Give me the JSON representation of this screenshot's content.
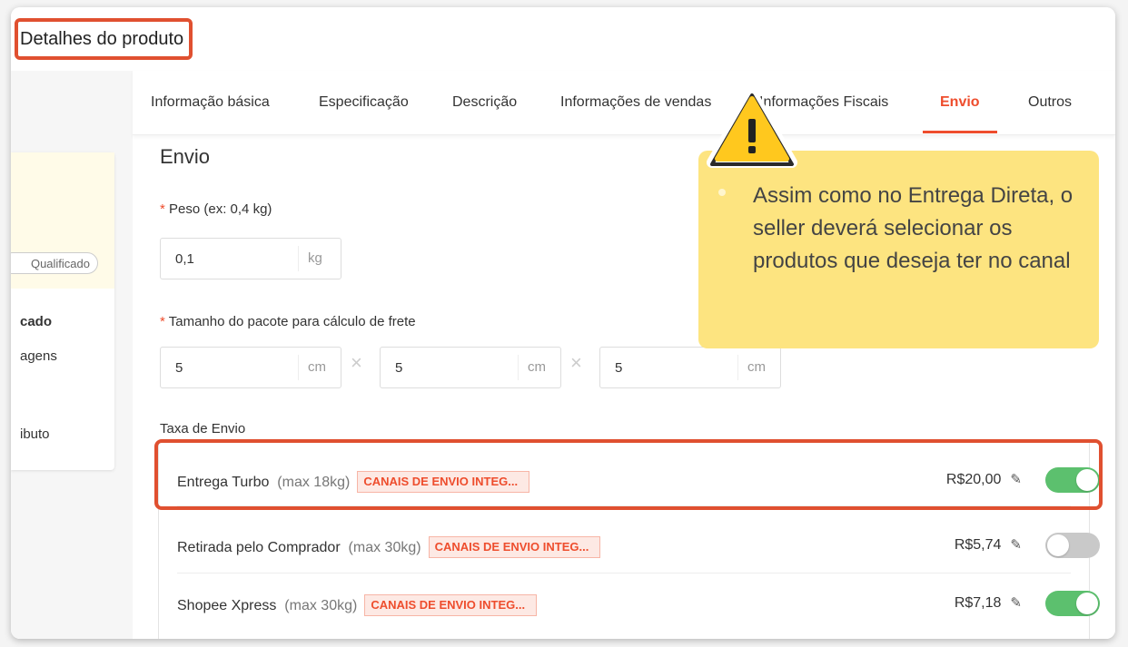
{
  "header": {
    "title": "Detalhes do produto"
  },
  "left": {
    "badge": "Qualificado",
    "items": [
      "cado",
      "agens",
      "ibuto"
    ]
  },
  "tabs": [
    {
      "label": "Informação básica"
    },
    {
      "label": "Especificação"
    },
    {
      "label": "Descrição"
    },
    {
      "label": "Informações de vendas"
    },
    {
      "label": "Informações Fiscais"
    },
    {
      "label": "Envio"
    },
    {
      "label": "Outros"
    }
  ],
  "section_title": "Envio",
  "weight": {
    "required": "*",
    "label": "Peso (ex: 0,4 kg)",
    "value": "0,1",
    "unit": "kg"
  },
  "package": {
    "required": "*",
    "label": "Tamanho do pacote para cálculo de frete",
    "dims": [
      {
        "value": "5",
        "unit": "cm"
      },
      {
        "value": "5",
        "unit": "cm"
      },
      {
        "value": "5",
        "unit": "cm"
      }
    ],
    "separator": "×"
  },
  "shipping": {
    "label": "Taxa de Envio",
    "rows": [
      {
        "name": "Entrega Turbo",
        "max": "(max 18kg)",
        "tag": "CANAIS DE ENVIO INTEG...",
        "price": "R$20,00",
        "enabled": true
      },
      {
        "name": "Retirada pelo Comprador",
        "max": "(max 30kg)",
        "tag": "CANAIS DE ENVIO INTEG...",
        "price": "R$5,74",
        "enabled": false
      },
      {
        "name": "Shopee Xpress",
        "max": "(max 30kg)",
        "tag": "CANAIS DE ENVIO INTEG...",
        "price": "R$7,18",
        "enabled": true
      }
    ]
  },
  "callout": {
    "text": "Assim como no Entrega Direta, o seller deverá selecionar os produtos que deseja ter no canal",
    "icon": "warning-icon"
  },
  "colors": {
    "accent": "#ee4d2d",
    "toggle_on": "#5cc06e",
    "callout": "#fde37a",
    "highlight": "#e05030"
  }
}
